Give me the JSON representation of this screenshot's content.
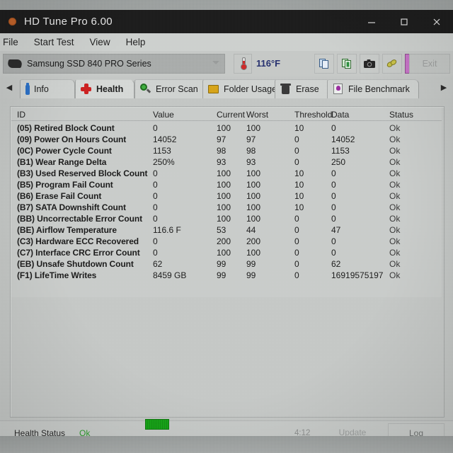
{
  "window": {
    "title": "HD Tune Pro 6.00",
    "app_icon": "orange-dot-icon",
    "controls": {
      "minimize": "minimize-icon",
      "maximize": "maximize-icon",
      "close": "close-icon"
    }
  },
  "menubar": {
    "items": [
      {
        "label": "File"
      },
      {
        "label": "Start Test"
      },
      {
        "label": "View"
      },
      {
        "label": "Help"
      }
    ]
  },
  "toolbar": {
    "drive": {
      "selected": "Samsung SSD 840 PRO Series",
      "icon": "hard-drive-icon",
      "caret": "chevron-down-icon"
    },
    "temperature": {
      "icon": "thermometer-icon",
      "value": "116°F"
    },
    "buttons": [
      {
        "name": "copy-icon",
        "label": ""
      },
      {
        "name": "copy-excel-icon",
        "label": ""
      },
      {
        "name": "camera-icon",
        "label": ""
      },
      {
        "name": "folder-link-icon",
        "label": ""
      },
      {
        "name": "download-arrow-icon",
        "label": "",
        "highlighted": true
      }
    ],
    "exit_label": "Exit"
  },
  "tabs": {
    "scroll_left": "◀",
    "scroll_right": "▶",
    "items": [
      {
        "label": "Info",
        "icon": "info-icon",
        "active": false
      },
      {
        "label": "Health",
        "icon": "red-cross-icon",
        "active": true
      },
      {
        "label": "Error Scan",
        "icon": "magnifier-icon",
        "active": false
      },
      {
        "label": "Folder Usage",
        "icon": "folder-icon",
        "active": false
      },
      {
        "label": "Erase",
        "icon": "trash-icon",
        "active": false
      },
      {
        "label": "File Benchmark",
        "icon": "benchmark-icon",
        "active": false
      }
    ]
  },
  "table": {
    "columns": [
      "ID",
      "Value",
      "Current",
      "Worst",
      "Threshold",
      "Data",
      "Status"
    ],
    "rows": [
      {
        "id": "(05) Retired Block Count",
        "value": "0",
        "current": "100",
        "worst": "100",
        "threshold": "10",
        "data": "0",
        "status": "Ok"
      },
      {
        "id": "(09) Power On Hours Count",
        "value": "14052",
        "current": "97",
        "worst": "97",
        "threshold": "0",
        "data": "14052",
        "status": "Ok"
      },
      {
        "id": "(0C) Power Cycle Count",
        "value": "1153",
        "current": "98",
        "worst": "98",
        "threshold": "0",
        "data": "1153",
        "status": "Ok"
      },
      {
        "id": "(B1) Wear Range Delta",
        "value": "250%",
        "current": "93",
        "worst": "93",
        "threshold": "0",
        "data": "250",
        "status": "Ok"
      },
      {
        "id": "(B3) Used Reserved Block Count",
        "value": "0",
        "current": "100",
        "worst": "100",
        "threshold": "10",
        "data": "0",
        "status": "Ok"
      },
      {
        "id": "(B5) Program Fail Count",
        "value": "0",
        "current": "100",
        "worst": "100",
        "threshold": "10",
        "data": "0",
        "status": "Ok"
      },
      {
        "id": "(B6) Erase Fail Count",
        "value": "0",
        "current": "100",
        "worst": "100",
        "threshold": "10",
        "data": "0",
        "status": "Ok"
      },
      {
        "id": "(B7) SATA Downshift Count",
        "value": "0",
        "current": "100",
        "worst": "100",
        "threshold": "10",
        "data": "0",
        "status": "Ok"
      },
      {
        "id": "(BB) Uncorrectable Error Count",
        "value": "0",
        "current": "100",
        "worst": "100",
        "threshold": "0",
        "data": "0",
        "status": "Ok"
      },
      {
        "id": "(BE) Airflow Temperature",
        "value": "116.6 F",
        "current": "53",
        "worst": "44",
        "threshold": "0",
        "data": "47",
        "status": "Ok"
      },
      {
        "id": "(C3) Hardware ECC Recovered",
        "value": "0",
        "current": "200",
        "worst": "200",
        "threshold": "0",
        "data": "0",
        "status": "Ok"
      },
      {
        "id": "(C7) Interface CRC Error Count",
        "value": "0",
        "current": "100",
        "worst": "100",
        "threshold": "0",
        "data": "0",
        "status": "Ok"
      },
      {
        "id": "(EB) Unsafe Shutdown Count",
        "value": "62",
        "current": "99",
        "worst": "99",
        "threshold": "0",
        "data": "62",
        "status": "Ok"
      },
      {
        "id": "(F1) LifeTime Writes",
        "value": "8459 GB",
        "current": "99",
        "worst": "99",
        "threshold": "0",
        "data": "16919575197",
        "status": "Ok"
      }
    ]
  },
  "statusbar": {
    "health_label": "Health Status",
    "health_value": "Ok",
    "health_color": "#2e9a2e",
    "progress_percent": 100,
    "time": "4:12",
    "update_label": "Update",
    "log_label": "Log"
  }
}
